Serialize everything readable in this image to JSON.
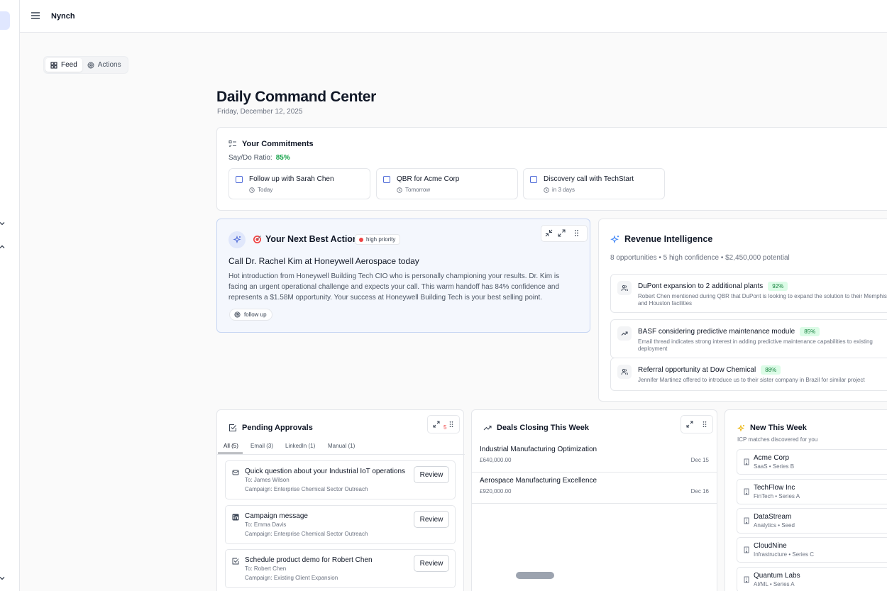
{
  "app": {
    "name": "Nynch"
  },
  "view_toggle": {
    "feed": "Feed",
    "actions": "Actions"
  },
  "page": {
    "title": "Daily Command Center",
    "date": "Friday, December 12, 2025"
  },
  "commitments": {
    "title": "Your Commitments",
    "ratio_label": "Say/Do Ratio:",
    "ratio_value": "85%",
    "items": [
      {
        "title": "Follow up with Sarah Chen",
        "due": "Today"
      },
      {
        "title": "QBR for Acme Corp",
        "due": "Tomorrow"
      },
      {
        "title": "Discovery call with TechStart",
        "due": "in 3 days"
      }
    ]
  },
  "next_best_action": {
    "title": "Your Next Best Action",
    "priority": "high priority",
    "refresh": "Refresh",
    "action": "Call Dr. Rachel Kim at Honeywell Aerospace today",
    "description": "Hot introduction from Honeywell Building Tech CIO who is personally championing your results. Dr. Kim is facing an urgent operational challenge and expects your call. This warm handoff has 84% confidence and represents a $1.58M opportunity. Your success at Honeywell Building Tech is your best selling point.",
    "tag": "follow up"
  },
  "revenue_intelligence": {
    "title": "Revenue Intelligence",
    "summary": "8 opportunities • 5 high confidence • $2,450,000 potential",
    "items": [
      {
        "title": "DuPont expansion to 2 additional plants",
        "confidence": "92%",
        "detail": "Robert Chen mentioned during QBR that DuPont is looking to expand the solution to their Memphis and Houston facilities",
        "icon": "users-icon"
      },
      {
        "title": "BASF considering predictive maintenance module",
        "confidence": "85%",
        "detail": "Email thread indicates strong interest in adding predictive maintenance capabilities to existing deployment",
        "icon": "trending-up-icon"
      },
      {
        "title": "Referral opportunity at Dow Chemical",
        "confidence": "88%",
        "detail": "Jennifer Martinez offered to introduce us to their sister company in Brazil for similar project",
        "icon": "users-icon"
      }
    ]
  },
  "pending_approvals": {
    "title": "Pending Approvals",
    "badge": "5",
    "tabs": [
      "All (5)",
      "Email (3)",
      "LinkedIn (1)",
      "Manual (1)"
    ],
    "review_label": "Review",
    "items": [
      {
        "title": "Quick question about your Industrial IoT operations",
        "to": "To: James Wilson",
        "campaign": "Campaign: Enterprise Chemical Sector Outreach",
        "icon": "mail-icon"
      },
      {
        "title": "Campaign message",
        "to": "To: Emma Davis",
        "campaign": "Campaign: Enterprise Chemical Sector Outreach",
        "icon": "linkedin-icon"
      },
      {
        "title": "Schedule product demo for Robert Chen",
        "to": "To: Robert Chen",
        "campaign": "Campaign: Existing Client Expansion",
        "icon": "check-square-icon"
      }
    ]
  },
  "deals": {
    "title": "Deals Closing This Week",
    "items": [
      {
        "name": "Industrial Manufacturing Optimization",
        "value": "£640,000.00",
        "date": "Dec 15"
      },
      {
        "name": "Aerospace Manufacturing Excellence",
        "value": "£920,000.00",
        "date": "Dec 16"
      }
    ]
  },
  "new_this_week": {
    "title": "New This Week",
    "subtitle": "ICP matches discovered for you",
    "items": [
      {
        "name": "Acme Corp",
        "meta": "SaaS • Series B"
      },
      {
        "name": "TechFlow Inc",
        "meta": "FinTech • Series A"
      },
      {
        "name": "DataStream",
        "meta": "Analytics • Seed"
      },
      {
        "name": "CloudNine",
        "meta": "Infrastructure • Series C"
      },
      {
        "name": "Quantum Labs",
        "meta": "AI/ML • Series A"
      }
    ]
  },
  "colors": {
    "accent": "#4f6bd8",
    "success": "#16a34a",
    "danger": "#ef4444",
    "nba_bg": "#f4f7fd"
  }
}
